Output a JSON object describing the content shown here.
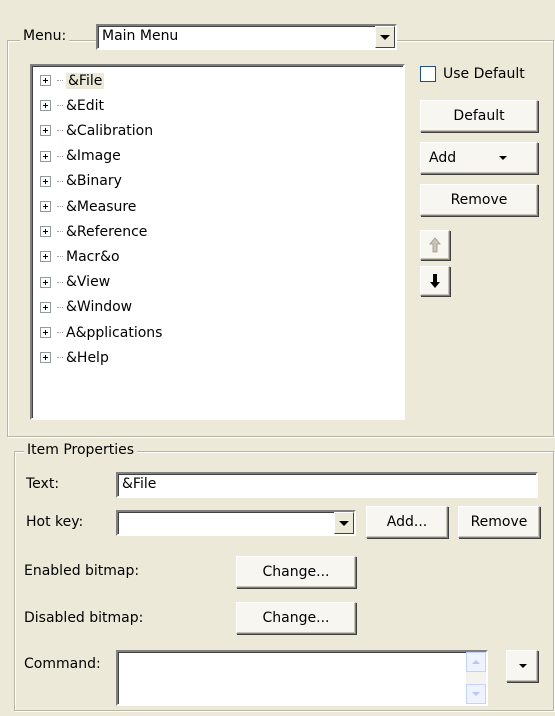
{
  "menu_group": {
    "label": "Menu:",
    "selected_menu": "Main Menu",
    "tree_items": [
      "&File",
      "&Edit",
      "&Calibration",
      "&Image",
      "&Binary",
      "&Measure",
      "&Reference",
      "Macr&o",
      "&View",
      "&Window",
      "A&pplications",
      "&Help"
    ],
    "use_default_label": "Use Default",
    "use_default_checked": false,
    "default_button": "Default",
    "add_button": "Add",
    "remove_button": "Remove"
  },
  "item_properties": {
    "label": "Item Properties",
    "text_label": "Text:",
    "text_value": "&File",
    "hotkey_label": "Hot key:",
    "hotkey_value": "",
    "hotkey_add_button": "Add...",
    "hotkey_remove_button": "Remove",
    "enabled_bitmap_label": "Enabled bitmap:",
    "enabled_change_button": "Change...",
    "disabled_bitmap_label": "Disabled bitmap:",
    "disabled_change_button": "Change...",
    "command_label": "Command:",
    "command_value": ""
  }
}
